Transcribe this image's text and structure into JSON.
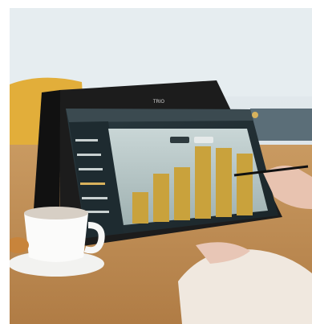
{
  "photo": {
    "laptop_brand": "TRIO"
  },
  "app": {
    "sidebar": {
      "items": [
        {
          "icon": "dashboard-icon"
        },
        {
          "icon": "chart-icon"
        },
        {
          "icon": "people-icon"
        },
        {
          "icon": "settings-icon"
        },
        {
          "icon": "folder-icon"
        }
      ]
    },
    "chart_data": {
      "type": "bar",
      "values": [
        18,
        28,
        31,
        42,
        40,
        36
      ],
      "color": "#c9a23c"
    }
  }
}
